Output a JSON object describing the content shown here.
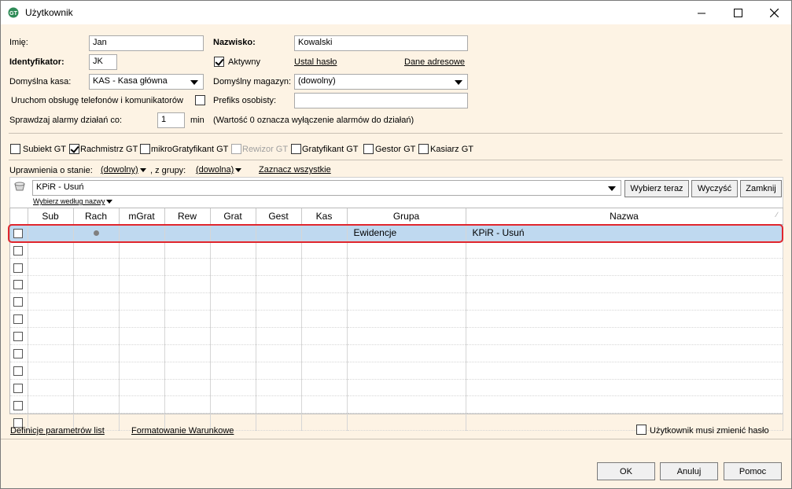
{
  "window": {
    "title": "Użytkownik"
  },
  "form": {
    "imie_label": "Imię:",
    "imie_value": "Jan",
    "nazwisko_label": "Nazwisko:",
    "nazwisko_value": "Kowalski",
    "identyfikator_label": "Identyfikator:",
    "identyfikator_value": "JK",
    "aktywny_label": "Aktywny",
    "aktywny_checked": true,
    "ustal_haslo": "Ustal hasło",
    "dane_adresowe": "Dane adresowe",
    "kasa_label": "Domyślna kasa:",
    "kasa_value": "KAS - Kasa główna",
    "magazyn_label": "Domyślny magazyn:",
    "magazyn_value": "(dowolny)",
    "telefony_label": "Uruchom obsługę telefonów i komunikatorów",
    "prefiks_label": "Prefiks osobisty:",
    "prefiks_value": "",
    "alarmy_label": "Sprawdzaj alarmy działań co:",
    "alarmy_value": "1",
    "alarmy_unit": "min",
    "alarmy_note": "(Wartość 0 oznacza wyłączenie alarmów do działań)"
  },
  "modules": [
    {
      "label": "Subiekt GT",
      "checked": false,
      "disabled": false
    },
    {
      "label": "Rachmistrz GT",
      "checked": true,
      "disabled": false
    },
    {
      "label": "mikroGratyfikant GT",
      "checked": false,
      "disabled": false
    },
    {
      "label": "Rewizor GT",
      "checked": false,
      "disabled": true
    },
    {
      "label": "Gratyfikant GT",
      "checked": false,
      "disabled": false
    },
    {
      "label": "Gestor GT",
      "checked": false,
      "disabled": false
    },
    {
      "label": "Kasiarz GT",
      "checked": false,
      "disabled": false
    }
  ],
  "filter": {
    "stan_label": "Uprawnienia o stanie:",
    "stan_value": "(dowolny)",
    "grupa_label": ", z grupy:",
    "grupa_value": "(dowolna)",
    "zaznacz": "Zaznacz wszystkie",
    "search_value": "KPiR - Usuń",
    "search_hint": "Wybierz według nazwy",
    "btn_wybierz": "Wybierz teraz",
    "btn_wyczysc": "Wyczyść",
    "btn_zamknij": "Zamknij"
  },
  "grid": {
    "columns": [
      "",
      "Sub",
      "Rach",
      "mGrat",
      "Rew",
      "Grat",
      "Gest",
      "Kas",
      "Grupa",
      "Nazwa"
    ],
    "rows": [
      {
        "grupa": "Ewidencje",
        "nazwa": "KPiR - Usuń",
        "rach": true,
        "selected": true
      }
    ],
    "empty_rows": 11
  },
  "footer": {
    "definicje": "Definicje parametrów list",
    "formatowanie": "Formatowanie Warunkowe",
    "musi_zmienic": "Użytkownik musi zmienić hasło",
    "ok": "OK",
    "anuluj": "Anuluj",
    "pomoc": "Pomoc"
  },
  "colors": {
    "selection": "#bfd9f0",
    "highlight": "#e0262e",
    "background": "#fdf3e4"
  }
}
